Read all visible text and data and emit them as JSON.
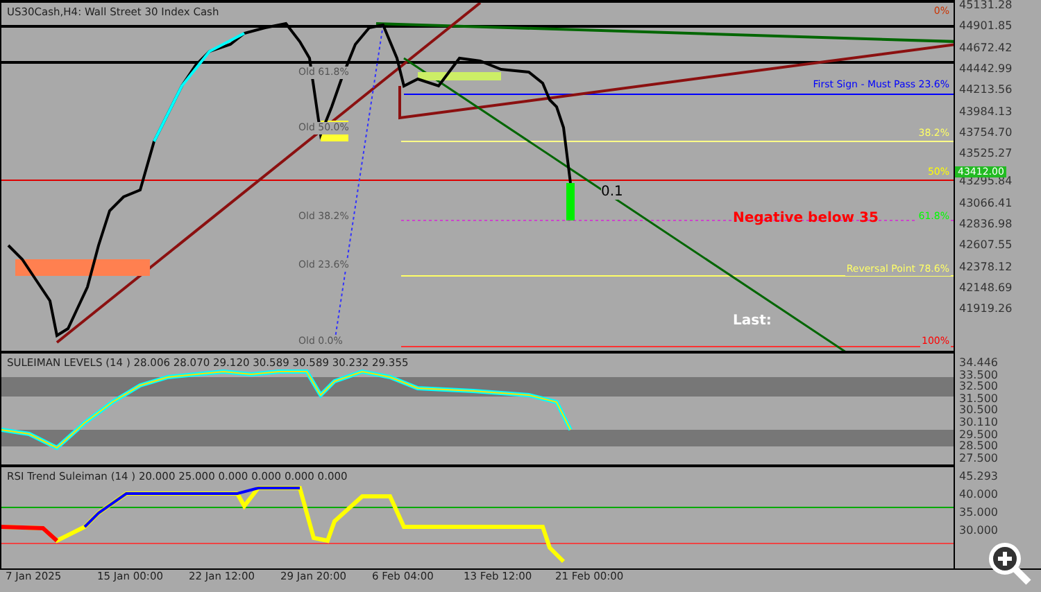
{
  "chart": {
    "title": "US30Cash,H4:  Wall Street 30 Index Cash",
    "price_axis": [
      "45131.28",
      "44901.85",
      "44672.42",
      "44442.99",
      "44213.56",
      "43984.13",
      "43754.70",
      "43525.27",
      "43295.84",
      "43066.41",
      "42836.98",
      "42607.55",
      "42378.12",
      "42148.69",
      "41919.26"
    ],
    "current_price": "43412.00",
    "fib_right": [
      {
        "label": "0%",
        "color": "#cc3300"
      },
      {
        "label": "First Sign - Must Pass  23.6%",
        "color": "#0000ff"
      },
      {
        "label": "38.2%",
        "color": "#ffff66"
      },
      {
        "label": "50%",
        "color": "#ffff00"
      },
      {
        "label": "61.8%",
        "color": "#00ff00"
      },
      {
        "label": "Reversal Point  78.6%",
        "color": "#ffff66"
      },
      {
        "label": "100%",
        "color": "#ff0000"
      }
    ],
    "fib_left": [
      "Old 61.8%",
      "Old 50.0%",
      "Old 38.2%",
      "Old 23.6%",
      "Old 0.0%"
    ],
    "annotations": [
      {
        "text": "Negative below 35",
        "kind": "warning"
      },
      {
        "text": "Last:",
        "kind": "note"
      },
      {
        "text": "0.1",
        "kind": "plain"
      }
    ]
  },
  "panel_1": {
    "title": "SULEIMAN LEVELS (14 )  28.006 28.070 29.120 30.589 30.589 30.232 29.355",
    "axis": [
      "34.446",
      "33.500",
      "32.500",
      "31.500",
      "30.500",
      "30.110",
      "29.500",
      "28.500",
      "27.500"
    ]
  },
  "panel_2": {
    "title": "RSI Trend Suleiman (14 ) 20.000 25.000 0.000 0.000 0.000 0.000",
    "axis": [
      "45.293",
      "40.000",
      "35.000",
      "30.000"
    ]
  },
  "time_axis": [
    "7 Jan 2025",
    "15 Jan 00:00",
    "22 Jan 12:00",
    "29 Jan 20:00",
    "6 Feb 04:00",
    "13 Feb 12:00",
    "21 Feb 00:00"
  ]
}
